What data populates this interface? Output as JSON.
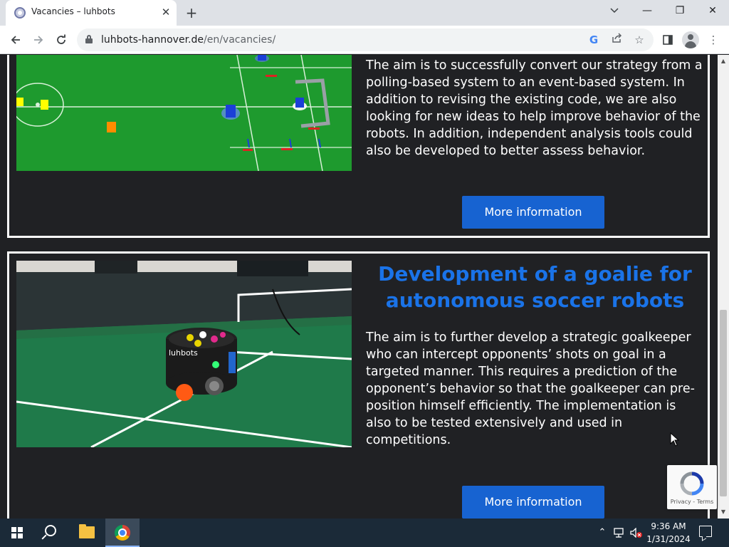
{
  "browser": {
    "tab_title": "Vacancies – luhbots",
    "new_tab_symbol": "+",
    "url_host": "luhbots-hannover.de",
    "url_path": "/en/vacancies/",
    "tab_list_icon": "chevron-down-icon",
    "minimize_symbol": "—",
    "restore_symbol": "❐",
    "close_symbol": "✕"
  },
  "main": {
    "cards": [
      {
        "image_icon": "robot-soccer-simulation-image",
        "description": "The aim is to successfully convert our strategy from a polling-based system to an event-based system. In addition to revising the existing code, we are also looking for new ideas to help improve behavior of the robots. In addition, independent analysis tools could also be developed to better assess behavior.",
        "button_label": "More information"
      },
      {
        "image_icon": "soccer-robot-photo",
        "title": "Development of a goalie for autonomous soccer robots",
        "description": "The aim is to further develop a strategic goalkeeper who can intercept opponents’ shots on goal in a targeted manner. This requires a prediction of the opponent’s behavior so that the goalkeeper can pre-position himself efficiently. The implementation is also to be tested extensively and used in competitions.",
        "button_label": "More information",
        "robot_label": "luhbots"
      }
    ]
  },
  "recaptcha": {
    "links": "Privacy - Terms"
  },
  "taskbar": {
    "time": "9:36 AM",
    "date": "1/31/2024"
  },
  "colors": {
    "page_background": "#202124",
    "card_border": "#ffffff",
    "title_blue": "#1a73e8",
    "button_blue": "#1763d1",
    "field_green": "#1e9a2e"
  }
}
